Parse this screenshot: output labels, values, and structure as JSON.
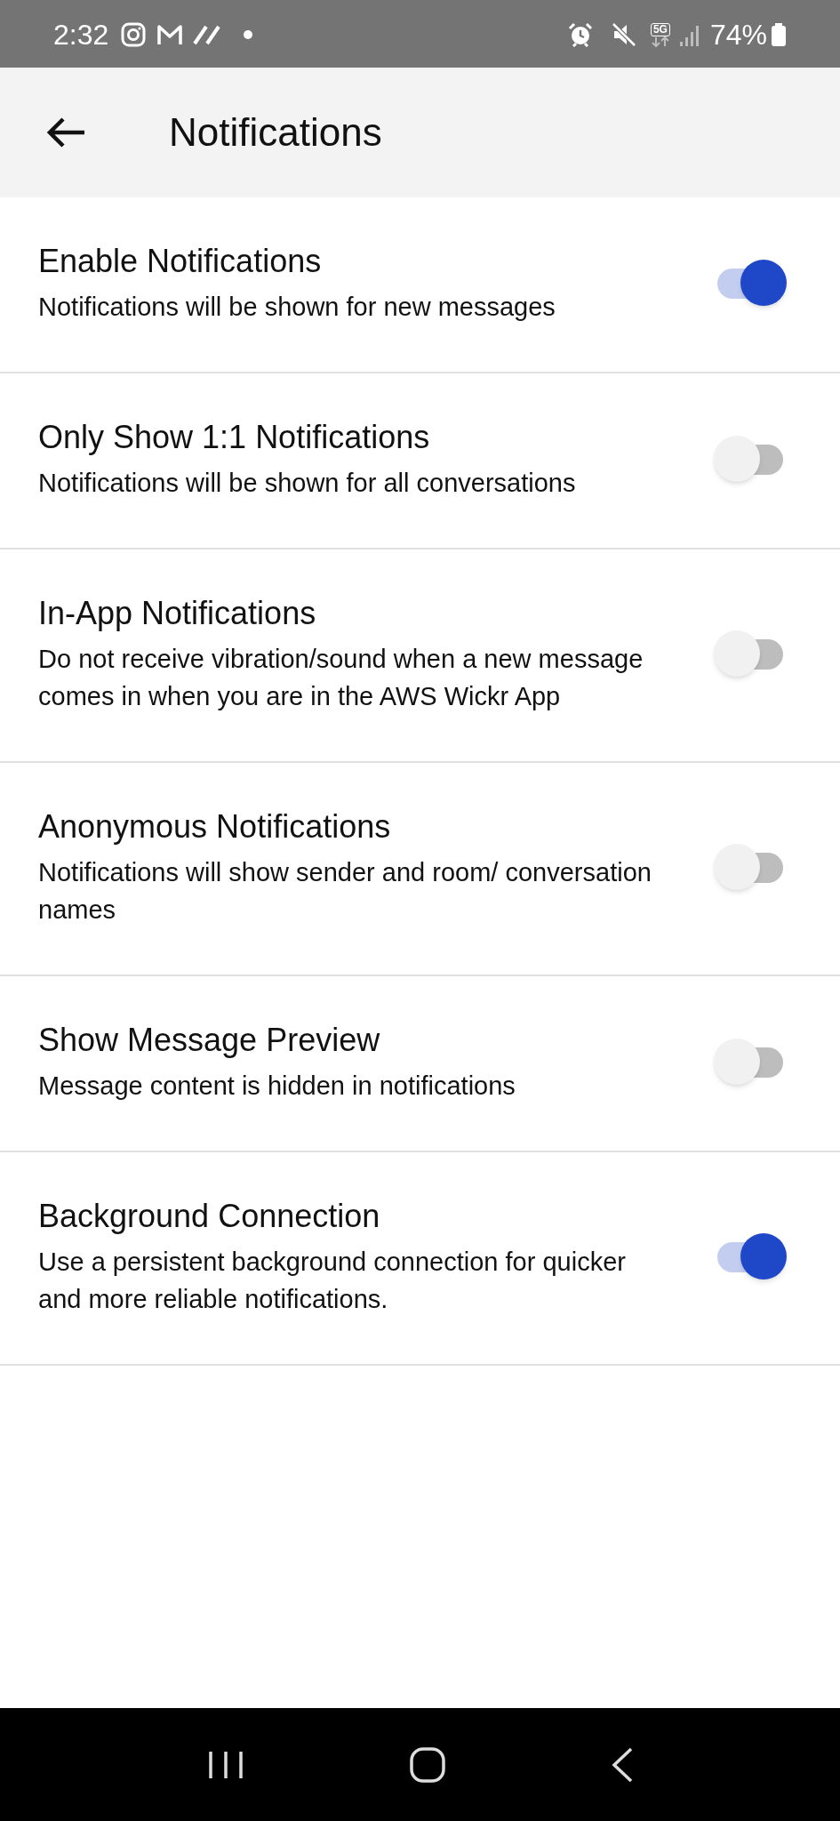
{
  "status_bar": {
    "time": "2:32",
    "network": "5G",
    "battery": "74%"
  },
  "header": {
    "title": "Notifications"
  },
  "settings": [
    {
      "title": "Enable Notifications",
      "description": "Notifications will be shown for new messages",
      "on": true
    },
    {
      "title": "Only Show 1:1 Notifications",
      "description": "Notifications will be shown for all conversations",
      "on": false
    },
    {
      "title": "In-App Notifications",
      "description": "Do not receive vibration/sound when a new message comes in when you are in the AWS Wickr App",
      "on": false
    },
    {
      "title": "Anonymous Notifications",
      "description": "Notifications will show sender and room/ conversation names",
      "on": false
    },
    {
      "title": "Show Message Preview",
      "description": "Message content is hidden in notifications",
      "on": false
    },
    {
      "title": "Background Connection",
      "description": "Use a persistent background connection for quicker and more reliable notifications.",
      "on": true
    }
  ]
}
